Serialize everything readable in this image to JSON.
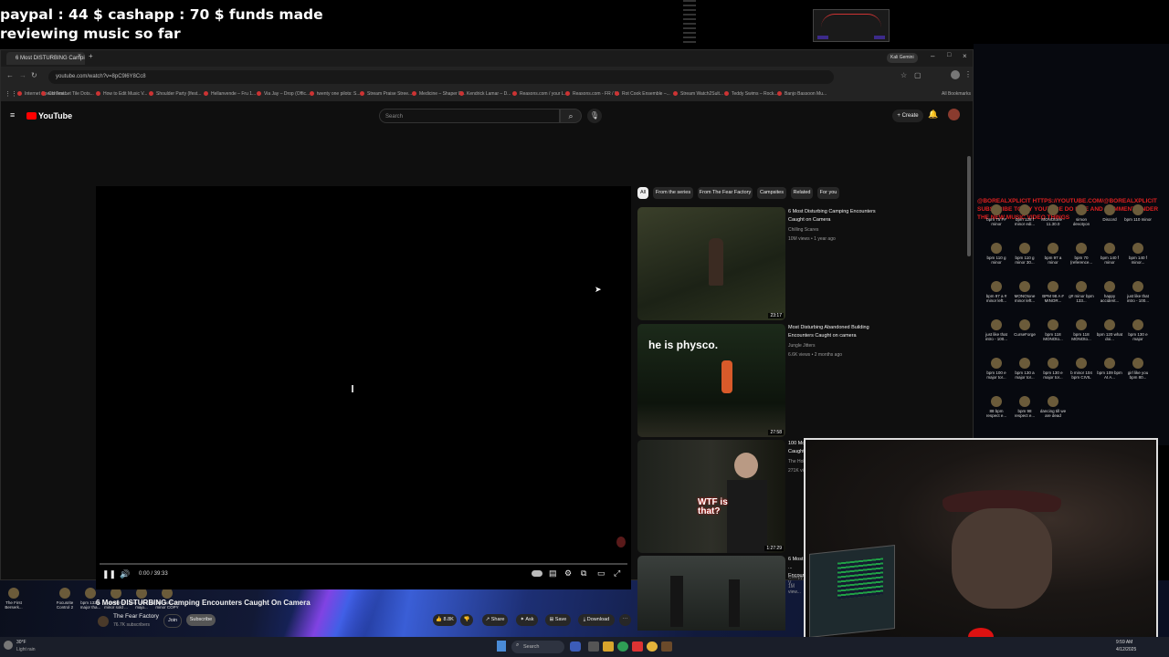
{
  "overlay": {
    "line1": "paypal : 44 $  cashapp : 70 $ funds made",
    "line2": "reviewing music so far"
  },
  "browser": {
    "tab_title": "6 Most DISTURBING Camping E",
    "url": "youtube.com/watch?v=8pC9l6Y8Cc8",
    "profile_label": "Kali Gemini",
    "all_bookmarks": "All Bookmarks",
    "bookmarks": [
      "Internet Speed Test...",
      "Chromebet Tile Dots...",
      "How to Edit Music V...",
      "Shoulder Party (lfest...",
      "Hellanvende – Fru 1...",
      "Via Jay – Drop (Offic...",
      "twenty one pilots: S...",
      "Stream Praise Stree...",
      "Medicine – Shaper E...",
      "Kendrick Lamar – D...",
      "Reasons.com / your L...",
      "Reasons.com - FR / I...",
      "Rot Cook Ensemble –...",
      "Stream Watch2Sult...",
      "Teddy Swims – Rock...",
      "Banjo Bassoon Mu..."
    ]
  },
  "youtube": {
    "logo": "YouTube",
    "search_placeholder": "Search",
    "create": "Create",
    "player": {
      "time": "0:00 / 39:33"
    },
    "video_title": "6 Most DISTURBING Camping Encounters Caught On Camera",
    "channel": "The Fear Factory",
    "subscribers": "76.7K subscribers",
    "join": "Join",
    "subscribe": "Subscribe",
    "likes": "8.8K",
    "share": "Share",
    "ask": "Ask",
    "save": "Save",
    "download": "Download",
    "chips": [
      "All",
      "From the series",
      "From The Fear Factory",
      "Campsites",
      "Related",
      "For you"
    ],
    "recommendations": [
      {
        "title": "6 Most Disturbing Camping Encounters Caught on Camera",
        "channel": "Chilling Scares",
        "meta": "10M views • 1 year ago",
        "duration": "23:17",
        "thumb_text": ""
      },
      {
        "title": "Most Disturbing Abandoned Building Encounters Caught on camera",
        "channel": "Jungle Jitters",
        "meta": "6.6K views • 2 months ago",
        "duration": "27:58",
        "thumb_text": "he is physco."
      },
      {
        "title": "100 Most Disturbing Forest Encounters Caught On Camera...",
        "channel": "The Hollow Mask",
        "meta": "271K views • 4 months ago",
        "duration": "1:27:29",
        "thumb_text": "WTF is that?"
      },
      {
        "title": "6 Most ... Encoun...",
        "channel": "Creepy V...",
        "meta": "1M view...",
        "duration": "",
        "thumb_text": ""
      }
    ]
  },
  "desktop_left_icons": [
    "The First Berserk...",
    "Focusrite Control 2",
    "bpm 132 A major tha...",
    "136 bpm e minor sold ...",
    "bpm 145 A flat majo...",
    "152 bpm c# minor COPY"
  ],
  "desktop_right_icons": [
    "bpm 75 F# minor",
    "bpm 128 f minor edi...",
    "MONOtone - 11.30.0",
    "simon devotyon",
    "Discord",
    "bpm 110 minor",
    "bpm 110 g minor",
    "bpm 110 g minor 30...",
    "bpm 97 a minor",
    "bpm 70 (reference...",
    "bpm 140 f minor",
    "bpm 140 f minor...",
    "bpm 97 a # minor left...",
    "MONOtone minor left...",
    "BPM 98 A # MINOR...",
    "g# minor bpm 133...",
    "happy accident...",
    "just like that intro - 100...",
    "just like that intro - 100...",
    "CurseForge",
    "bpm 118 MONOto...",
    "bpm 118 MONOto...",
    "bpm 120 what doi...",
    "bpm 130 e major",
    "bpm 100 e major tor...",
    "bpm 130 a major tor...",
    "bpm 130 e major tor...",
    "b minor 104 bpm CIVIL",
    "bpm 109 bpm At A...",
    "girl like you bpm 80...",
    "88 bpm respect e...",
    "bpm 98 respect e...",
    "dancing till we are dead"
  ],
  "red_overlay_text": "@BOREALXPLICIT HTTPS://YOUTUBE.COM/@BOREALXPLICIT SUBSCRIBE TO MY YOUTUBE DO LIKE AND COMMENT UNDER THE NEW MUSIC VIDEO THINGS",
  "taskbar": {
    "search": "Search",
    "weather_temp": "30°F",
    "weather_desc": "Light rain",
    "clock_time": "9:59 AM",
    "clock_date": "4/12/2025"
  },
  "colors": {
    "accent": "#ff0000",
    "youtube_bg": "#0f0f0f"
  }
}
